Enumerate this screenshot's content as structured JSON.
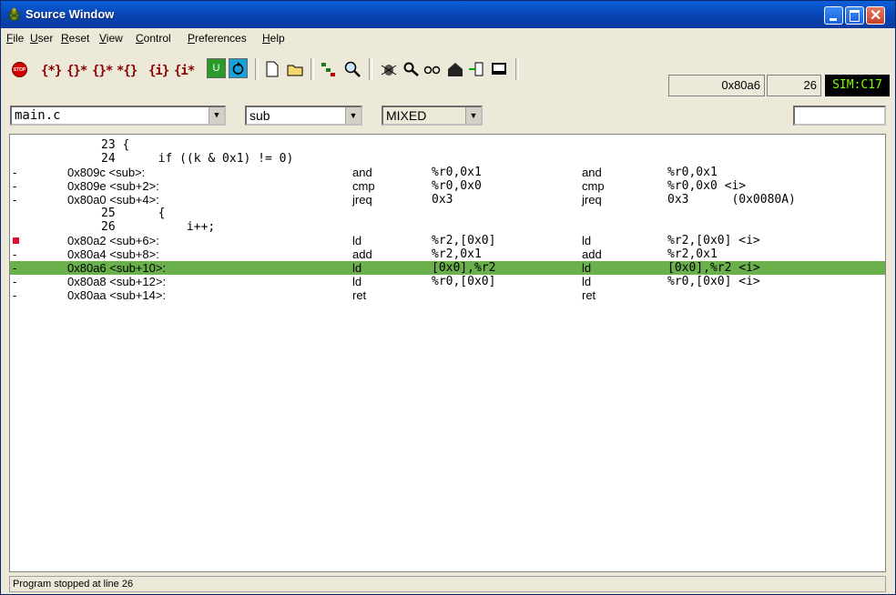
{
  "window": {
    "title": "Source Window"
  },
  "menu": [
    "File",
    "User",
    "Reset",
    "View",
    "Control",
    "Preferences",
    "Help"
  ],
  "toolbar": {
    "stop_label": "STOP",
    "u_label": "U",
    "pc": "0x80a6",
    "line": "26",
    "sim": "SIM:C17"
  },
  "combos": {
    "file": "main.c",
    "function": "sub",
    "mode": "MIXED",
    "goto": ""
  },
  "source": [
    {
      "gutter": "",
      "addr": "23 {",
      "m1": "",
      "o1": "",
      "m2": "",
      "o2": "",
      "src": true
    },
    {
      "gutter": "",
      "addr": "24      if ((k & 0x1) != 0)",
      "m1": "",
      "o1": "",
      "m2": "",
      "o2": "",
      "src": true
    },
    {
      "gutter": "-",
      "addr": "0x809c <sub>:",
      "m1": "and",
      "o1": "%r0,0x1",
      "m2": "and",
      "o2": "%r0,0x1"
    },
    {
      "gutter": "-",
      "addr": "0x809e <sub+2>:",
      "m1": "cmp",
      "o1": "%r0,0x0",
      "m2": "cmp",
      "o2": "%r0,0x0 <i>"
    },
    {
      "gutter": "-",
      "addr": "0x80a0 <sub+4>:",
      "m1": "jreq",
      "o1": "0x3",
      "m2": "jreq",
      "o2": "0x3      (0x0080A)"
    },
    {
      "gutter": "",
      "addr": "25      {",
      "m1": "",
      "o1": "",
      "m2": "",
      "o2": "",
      "src": true
    },
    {
      "gutter": "",
      "addr": "26          i++;",
      "m1": "",
      "o1": "",
      "m2": "",
      "o2": "",
      "src": true
    },
    {
      "gutter": "",
      "addr": "0x80a2 <sub+6>:",
      "m1": "ld",
      "o1": "%r2,[0x0]",
      "m2": "ld",
      "o2": "%r2,[0x0] <i>",
      "breakpoint": true
    },
    {
      "gutter": "-",
      "addr": "0x80a4 <sub+8>:",
      "m1": "add",
      "o1": "%r2,0x1",
      "m2": "add",
      "o2": "%r2,0x1"
    },
    {
      "gutter": "-",
      "addr": "0x80a6 <sub+10>:",
      "m1": "ld",
      "o1": "[0x0],%r2",
      "m2": "ld",
      "o2": "[0x0],%r2 <i>",
      "current": true
    },
    {
      "gutter": "-",
      "addr": "0x80a8 <sub+12>:",
      "m1": "ld",
      "o1": "%r0,[0x0]",
      "m2": "ld",
      "o2": "%r0,[0x0] <i>"
    },
    {
      "gutter": "-",
      "addr": "0x80aa <sub+14>:",
      "m1": "ret",
      "o1": "",
      "m2": "ret",
      "o2": ""
    }
  ],
  "status": "Program stopped at line 26",
  "colors": {
    "titlebar": "#0a5fd8",
    "highlight": "#6ab04c",
    "breakpoint": "#e01030",
    "sim_text": "#7fff00"
  }
}
